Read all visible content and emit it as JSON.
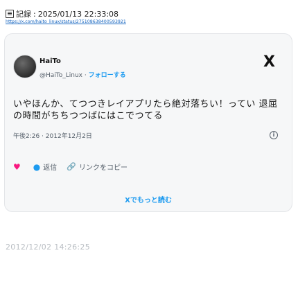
{
  "header": {
    "record_label": "記録",
    "record_time": "2025/01/13 22:33:08",
    "source_url": "https://x.com/haito_linux/status/275108638400593921"
  },
  "post": {
    "display_name": "HaiTo",
    "handle": "@HaiTo_Linux",
    "separator": "·",
    "follow_label": "フォローする",
    "text": "いやほんか、てつつきレイアプリたら絶対落ちい！ってい 退屈の時間がちちつつばにはこでつてる",
    "timestamp": "午後2:26 · 2012年12月2日",
    "info_symbol": "i"
  },
  "actions": {
    "like_count": "",
    "reply_label": "返信",
    "share_label": "リンクをコピー"
  },
  "readmore_label": "Xでもっと読む",
  "watermark": "2012/12/02 14:26:25",
  "icons": {
    "x_logo": "X",
    "heart": "♥",
    "reply": "●",
    "link": "🔗"
  },
  "colors": {
    "accent": "#1d9bf0",
    "heart": "#f91880",
    "link": "#1565c0"
  }
}
